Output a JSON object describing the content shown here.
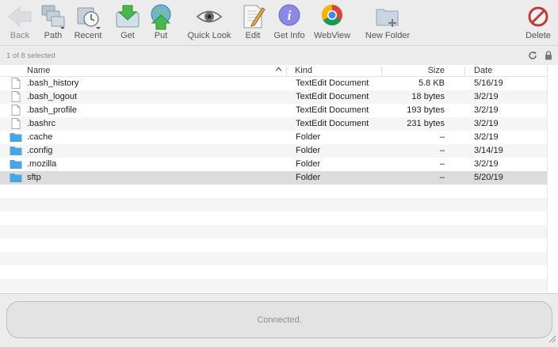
{
  "toolbar": {
    "back": "Back",
    "path": "Path",
    "recent": "Recent",
    "get": "Get",
    "put": "Put",
    "quick_look": "Quick Look",
    "edit": "Edit",
    "get_info": "Get Info",
    "webview": "WebView",
    "new_folder": "New Folder",
    "delete": "Delete"
  },
  "status": {
    "selection": "1 of 8 selected"
  },
  "columns": {
    "name": "Name",
    "kind": "Kind",
    "size": "Size",
    "date": "Date"
  },
  "files": [
    {
      "name": ".bash_history",
      "kind": "TextEdit Document",
      "size": "5.8 KB",
      "date": "5/16/19",
      "type": "document"
    },
    {
      "name": ".bash_logout",
      "kind": "TextEdit Document",
      "size": "18 bytes",
      "date": "3/2/19",
      "type": "document"
    },
    {
      "name": ".bash_profile",
      "kind": "TextEdit Document",
      "size": "193 bytes",
      "date": "3/2/19",
      "type": "document"
    },
    {
      "name": ".bashrc",
      "kind": "TextEdit Document",
      "size": "231 bytes",
      "date": "3/2/19",
      "type": "document"
    },
    {
      "name": ".cache",
      "kind": "Folder",
      "size": "–",
      "date": "3/2/19",
      "type": "folder"
    },
    {
      "name": ".config",
      "kind": "Folder",
      "size": "–",
      "date": "3/14/19",
      "type": "folder"
    },
    {
      "name": ".mozilla",
      "kind": "Folder",
      "size": "–",
      "date": "3/2/19",
      "type": "folder"
    },
    {
      "name": "sftp",
      "kind": "Folder",
      "size": "–",
      "date": "5/20/19",
      "type": "folder",
      "selected": true
    }
  ],
  "connection": {
    "status": "Connected."
  },
  "colors": {
    "folder": "#4aa6e0",
    "selected_row": "#dcdcdc",
    "stripe": "#f4f5f5"
  }
}
